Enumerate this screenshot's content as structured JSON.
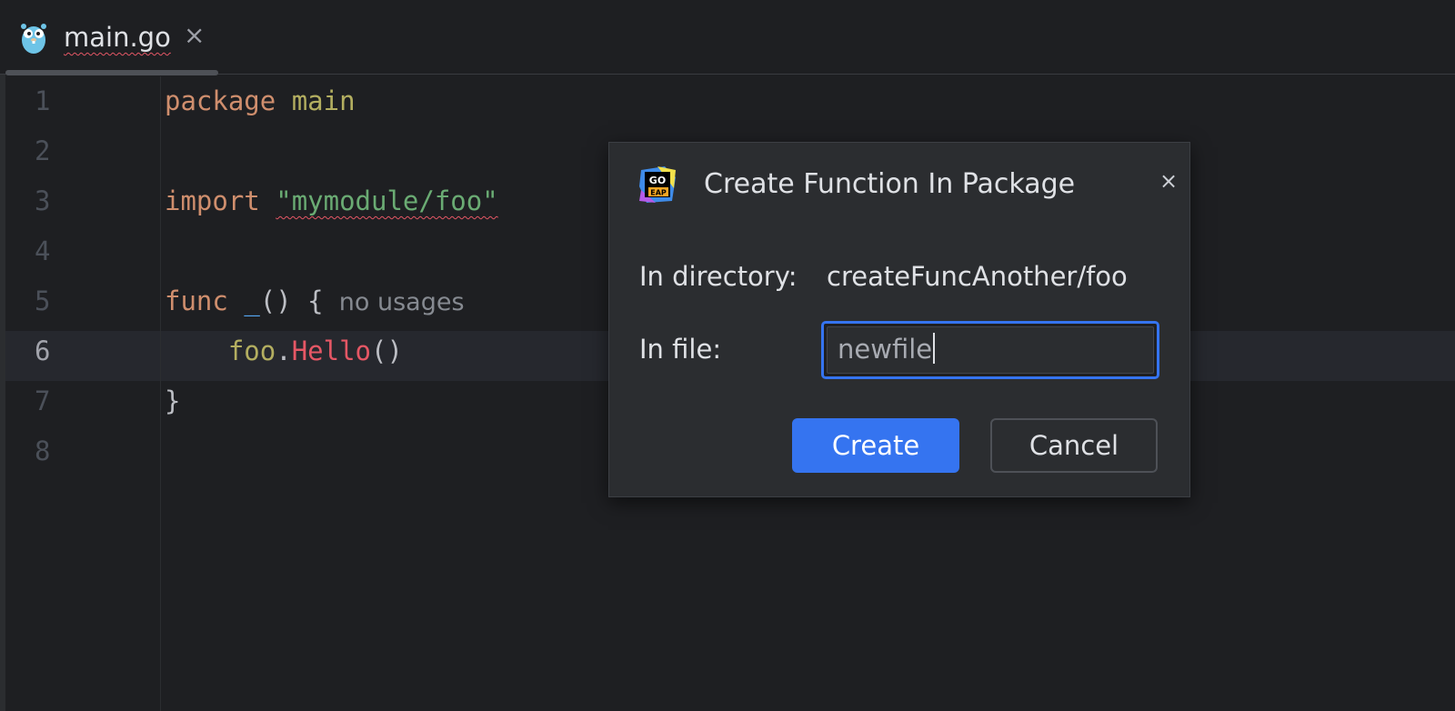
{
  "tab": {
    "filename": "main.go",
    "close_glyph": "×",
    "icon": "gopher-icon"
  },
  "editor": {
    "lines": [
      {
        "number": "1",
        "tokens": [
          {
            "t": "package",
            "c": "kw"
          },
          {
            "t": " ",
            "c": "plain"
          },
          {
            "t": "main",
            "c": "pkg"
          }
        ]
      },
      {
        "number": "2",
        "tokens": []
      },
      {
        "number": "3",
        "tokens": [
          {
            "t": "import",
            "c": "kw"
          },
          {
            "t": " ",
            "c": "plain"
          },
          {
            "t": "\"mymodule/foo\"",
            "c": "str"
          }
        ]
      },
      {
        "number": "4",
        "tokens": []
      },
      {
        "number": "5",
        "tokens": [
          {
            "t": "func",
            "c": "kw"
          },
          {
            "t": " ",
            "c": "plain"
          },
          {
            "t": "_",
            "c": "fn-decl"
          },
          {
            "t": "() {",
            "c": "plain"
          },
          {
            "t": "  no usages",
            "c": "hint"
          }
        ]
      },
      {
        "number": "6",
        "tokens": [
          {
            "t": "    ",
            "c": "plain"
          },
          {
            "t": "foo",
            "c": "pkg"
          },
          {
            "t": ".",
            "c": "plain"
          },
          {
            "t": "Hello",
            "c": "err"
          },
          {
            "t": "()",
            "c": "plain"
          }
        ]
      },
      {
        "number": "7",
        "tokens": [
          {
            "t": "}",
            "c": "plain"
          }
        ]
      },
      {
        "number": "8",
        "tokens": []
      }
    ],
    "active_line": "6"
  },
  "dialog": {
    "title": "Create Function In Package",
    "icon": "goland-eap-icon",
    "icon_text_top": "GO",
    "icon_text_bottom": "EAP",
    "close_glyph": "×",
    "directory_label": "In directory:",
    "directory_value": "createFuncAnother/foo",
    "file_label": "In file:",
    "file_value": "newfile",
    "create_label": "Create",
    "cancel_label": "Cancel"
  },
  "colors": {
    "background": "#1e1f22",
    "keyword": "#cf8e6d",
    "string": "#6aab73",
    "error": "#e55765",
    "accent": "#3574f0"
  }
}
